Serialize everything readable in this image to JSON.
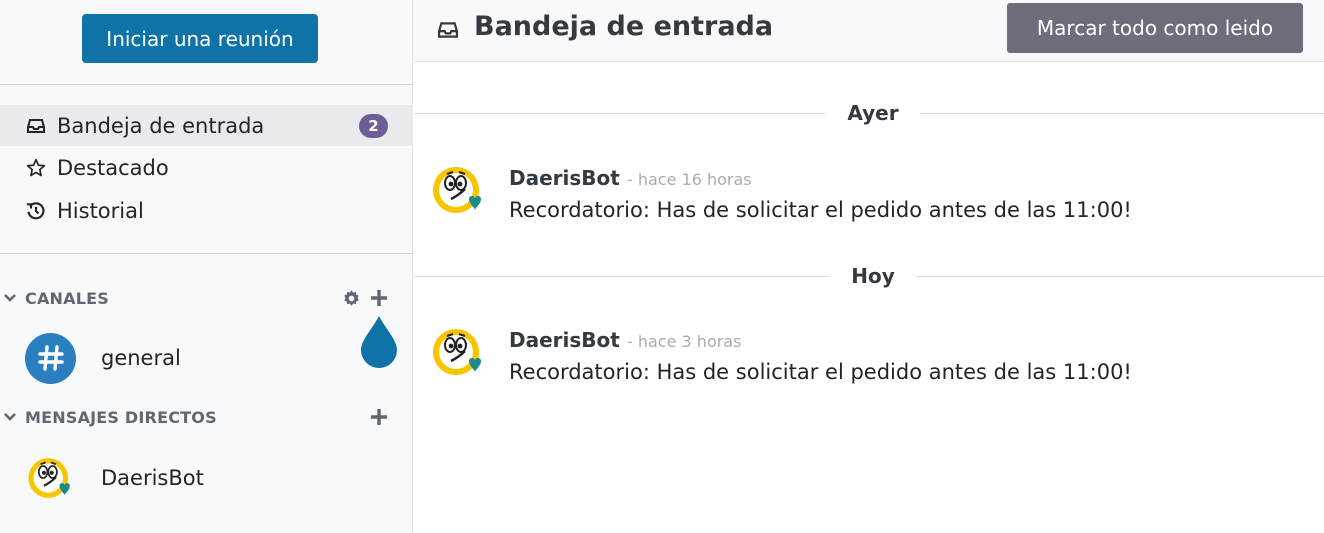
{
  "sidebar": {
    "start_meeting": "Iniciar una reunión",
    "nav": [
      {
        "label": "Bandeja de entrada",
        "icon": "inbox-icon",
        "badge": "2",
        "active": true
      },
      {
        "label": "Destacado",
        "icon": "star-icon"
      },
      {
        "label": "Historial",
        "icon": "history-icon"
      }
    ],
    "channels_header": "CANALES",
    "channels": [
      {
        "label": "general",
        "icon": "hash-icon"
      }
    ],
    "direct_header": "MENSAJES DIRECTOS",
    "direct": [
      {
        "label": "DaerisBot",
        "icon": "bot-avatar"
      }
    ]
  },
  "main": {
    "title": "Bandeja de entrada",
    "mark_all_read": "Marcar todo como leido",
    "groups": [
      {
        "day": "Ayer",
        "author": "DaerisBot",
        "time": "- hace 16 horas",
        "text": "Recordatorio: Has de solicitar el pedido antes de las 11:00!"
      },
      {
        "day": "Hoy",
        "author": "DaerisBot",
        "time": "- hace 3 horas",
        "text": "Recordatorio: Has de solicitar el pedido antes de las 11:00!"
      }
    ]
  },
  "colors": {
    "primary": "#0f73a8",
    "badge": "#6f5e96",
    "secondary_button": "#6c6e7a",
    "avatar_yellow": "#f6c500",
    "heart_teal": "#1a8a8a"
  }
}
